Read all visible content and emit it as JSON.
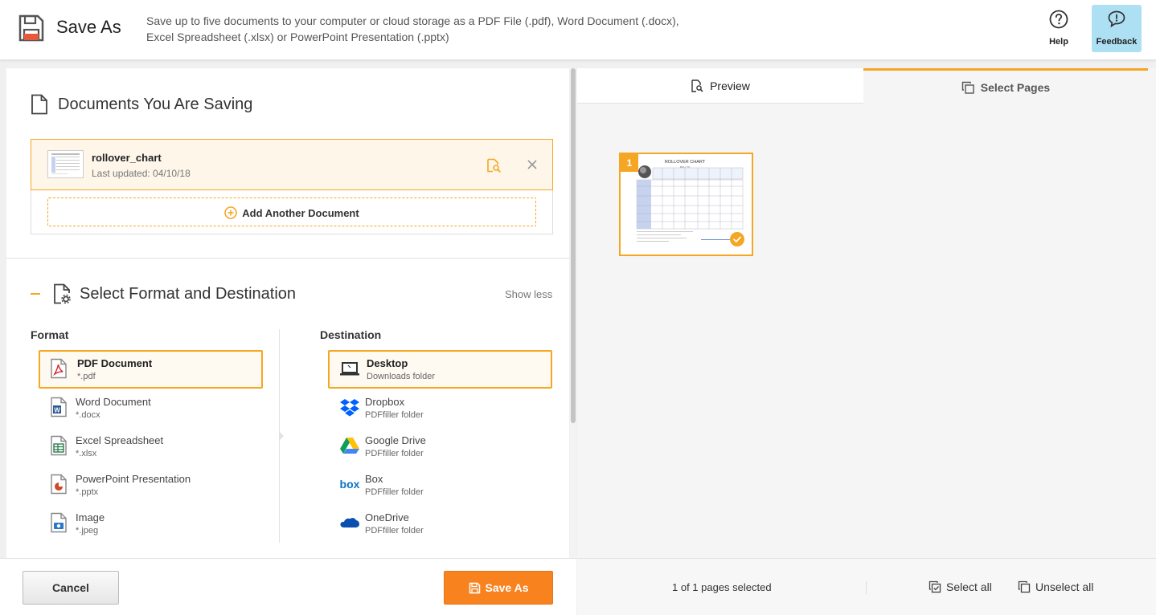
{
  "header": {
    "title": "Save As",
    "description": "Save up to five documents to your computer or cloud storage as a PDF File (.pdf), Word Document (.docx), Excel Spreadsheet (.xlsx) or PowerPoint Presentation (.pptx)",
    "help_label": "Help",
    "feedback_label": "Feedback"
  },
  "documents": {
    "title": "Documents You Are Saving",
    "items": [
      {
        "name": "rollover_chart",
        "updated": "Last updated: 04/10/18"
      }
    ],
    "add_label": "Add Another Document"
  },
  "format_section": {
    "title": "Select Format and Destination",
    "show_less": "Show less",
    "format_heading": "Format",
    "destination_heading": "Destination",
    "formats": [
      {
        "name": "PDF Document",
        "ext": "*.pdf",
        "selected": true
      },
      {
        "name": "Word Document",
        "ext": "*.docx",
        "selected": false
      },
      {
        "name": "Excel Spreadsheet",
        "ext": "*.xlsx",
        "selected": false
      },
      {
        "name": "PowerPoint Presentation",
        "ext": "*.pptx",
        "selected": false
      },
      {
        "name": "Image",
        "ext": "*.jpeg",
        "selected": false
      }
    ],
    "destinations": [
      {
        "name": "Desktop",
        "sub": "Downloads folder",
        "selected": true
      },
      {
        "name": "Dropbox",
        "sub": "PDFfiller folder",
        "selected": false
      },
      {
        "name": "Google Drive",
        "sub": "PDFfiller folder",
        "selected": false
      },
      {
        "name": "Box",
        "sub": "PDFfiller folder",
        "selected": false
      },
      {
        "name": "OneDrive",
        "sub": "PDFfiller folder",
        "selected": false
      }
    ]
  },
  "footer": {
    "cancel_label": "Cancel",
    "save_label": "Save As"
  },
  "preview_panel": {
    "tabs": [
      {
        "label": "Preview",
        "active": false
      },
      {
        "label": "Select Pages",
        "active": true
      }
    ],
    "pages": [
      {
        "number": "1",
        "selected": true
      }
    ],
    "thumb_text": {
      "title": "ROLLOVER CHART",
      "subtitle": "ROLL TO"
    },
    "selected_count": "1 of 1 pages selected",
    "select_all": "Select all",
    "unselect_all": "Unselect all"
  },
  "colors": {
    "accent": "#f5a623",
    "save_button": "#f7821e",
    "feedback_bg": "#aee0f3",
    "selected_bg": "#fdf6e9"
  }
}
